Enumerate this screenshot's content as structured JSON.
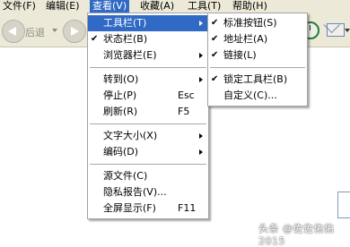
{
  "menubar": {
    "items": [
      {
        "label": "文件(F)"
      },
      {
        "label": "编辑(E)"
      },
      {
        "label": "查看(V)"
      },
      {
        "label": "收藏(A)"
      },
      {
        "label": "工具(T)"
      },
      {
        "label": "帮助(H)"
      }
    ]
  },
  "toolbar": {
    "back_label": "后退",
    "back_icon": "back-arrow-icon",
    "forward_icon": "forward-arrow-icon",
    "history_icon": "history-icon",
    "mail_icon": "mail-icon"
  },
  "view_menu": {
    "items": [
      {
        "label": "工具栏(T)",
        "checked": false,
        "submenu": true,
        "highlighted": true
      },
      {
        "label": "状态栏(B)",
        "checked": true
      },
      {
        "label": "浏览器栏(E)",
        "submenu": true
      },
      {
        "label": "转到(O)",
        "submenu": true
      },
      {
        "label": "停止(P)",
        "shortcut": "Esc"
      },
      {
        "label": "刷新(R)",
        "shortcut": "F5"
      },
      {
        "label": "文字大小(X)",
        "submenu": true
      },
      {
        "label": "编码(D)",
        "submenu": true
      },
      {
        "label": "源文件(C)"
      },
      {
        "label": "隐私报告(V)..."
      },
      {
        "label": "全屏显示(F)",
        "shortcut": "F11"
      }
    ]
  },
  "toolbars_submenu": {
    "items": [
      {
        "label": "标准按钮(S)",
        "checked": true
      },
      {
        "label": "地址栏(A)",
        "checked": true
      },
      {
        "label": "链接(L)",
        "checked": true
      },
      {
        "label": "锁定工具栏(B)",
        "checked": true
      },
      {
        "label": "自定义(C)..."
      }
    ]
  },
  "watermark": "头条 @佐佐佑佑2015",
  "colors": {
    "menu_highlight": "#316ac5",
    "menubar_bg": "#ece9d8"
  }
}
